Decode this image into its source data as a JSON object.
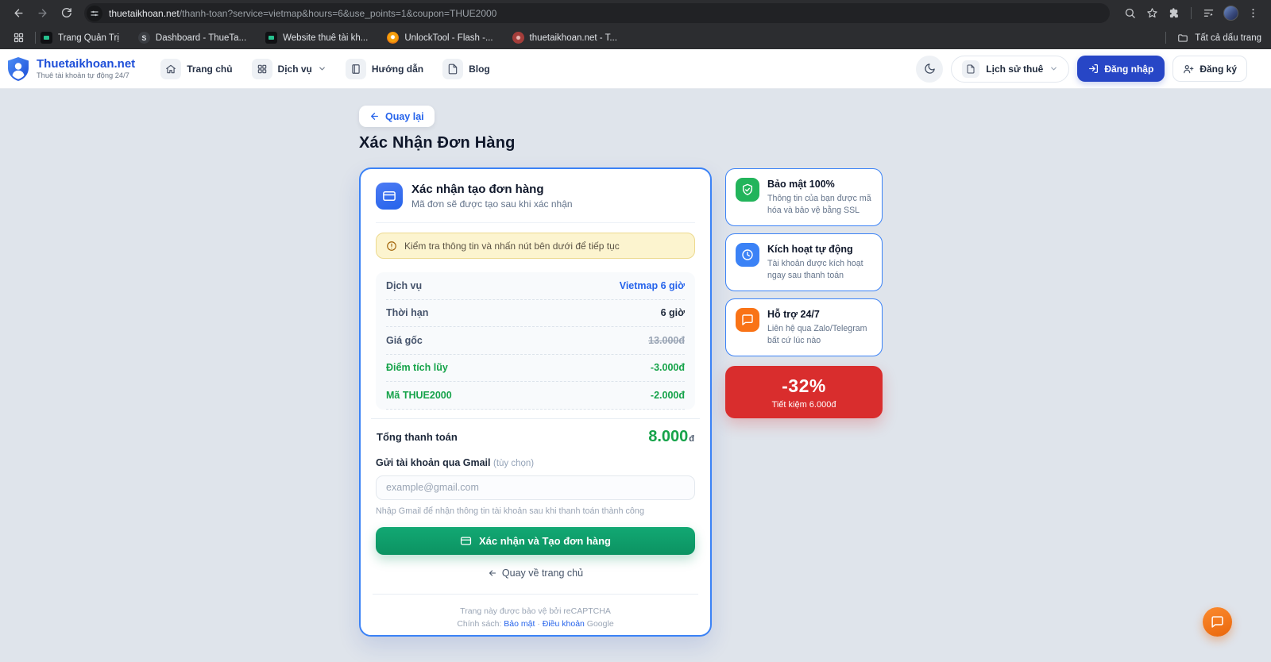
{
  "browser": {
    "url": {
      "domain": "thuetaikhoan.net",
      "path": "/thanh-toan?service=vietmap&hours=6&use_points=1&coupon=THUE2000"
    },
    "bookmarks": [
      {
        "label": "Trang Quản Trị"
      },
      {
        "label": "Dashboard - ThueTa..."
      },
      {
        "label": "Website thuê tài kh..."
      },
      {
        "label": "UnlockTool - Flash -..."
      },
      {
        "label": "thuetaikhoan.net - T..."
      }
    ],
    "all_bookmarks": "Tất cả dấu trang"
  },
  "header": {
    "brand": "Thuetaikhoan.net",
    "tagline": "Thuê tài khoản tự động 24/7",
    "nav_home": "Trang chủ",
    "nav_services": "Dịch vụ",
    "nav_guide": "Hướng dẫn",
    "nav_blog": "Blog",
    "history_button": "Lịch sử thuê",
    "login_button": "Đăng nhập",
    "register_button": "Đăng ký"
  },
  "main": {
    "back_button": "Quay lại",
    "title": "Xác Nhận Đơn Hàng",
    "card": {
      "title": "Xác nhận tạo đơn hàng",
      "subtitle": "Mã đơn sẽ được tạo sau khi xác nhận",
      "notice": "Kiểm tra thông tin và nhấn nút bên dưới để tiếp tục",
      "rows": [
        {
          "label": "Dịch vụ",
          "value": "Vietmap 6 giờ"
        },
        {
          "label": "Thời hạn",
          "value": "6 giờ"
        },
        {
          "label": "Giá gốc",
          "value": "13.000đ"
        },
        {
          "label": "Điểm tích lũy",
          "value": "-3.000đ"
        },
        {
          "label": "Mã THUE2000",
          "value": "-2.000đ"
        }
      ],
      "total_label": "Tổng thanh toán",
      "total_value": "8.000",
      "total_unit": "đ",
      "email_label": "Gửi tài khoản qua Gmail",
      "email_optional": "(tùy chọn)",
      "email_placeholder": "example@gmail.com",
      "email_help": "Nhập Gmail để nhận thông tin tài khoản sau khi thanh toán thành công",
      "submit_button": "Xác nhận và Tạo đơn hàng",
      "back_home": "Quay về trang chủ",
      "recaptcha_line": "Trang này được bảo vệ bởi reCAPTCHA",
      "policy_prefix": "Chính sách:",
      "policy_privacy": "Bảo mật",
      "policy_sep": "·",
      "policy_terms": "Điều khoản",
      "policy_google": "Google"
    },
    "benefits": [
      {
        "title": "Bảo mật 100%",
        "desc": "Thông tin của bạn được mã hóa và bảo vệ bằng SSL",
        "icon": "shield-check-icon",
        "color": "#22b45b"
      },
      {
        "title": "Kích hoạt tự động",
        "desc": "Tài khoản được kích hoạt ngay sau thanh toán",
        "icon": "clock-icon",
        "color": "#3b82f6"
      },
      {
        "title": "Hỗ trợ 24/7",
        "desc": "Liên hệ qua Zalo/Telegram bất cứ lúc nào",
        "icon": "chat-icon",
        "color": "#f97316"
      }
    ],
    "discount": {
      "percent": "-32%",
      "note": "Tiết kiệm 6.000đ"
    }
  },
  "colors": {
    "accent_blue": "#2563eb",
    "card_border": "#3b82f6",
    "login_blue": "#2746c6",
    "success_green": "#16a34a",
    "button_green": "#0f9d6a",
    "discount_red": "#d92d2d",
    "chat_orange": "#f97316",
    "warning_bg": "#fcf4cf",
    "warning_border": "#ecd98e",
    "page_bg": "#dfe4eb"
  }
}
